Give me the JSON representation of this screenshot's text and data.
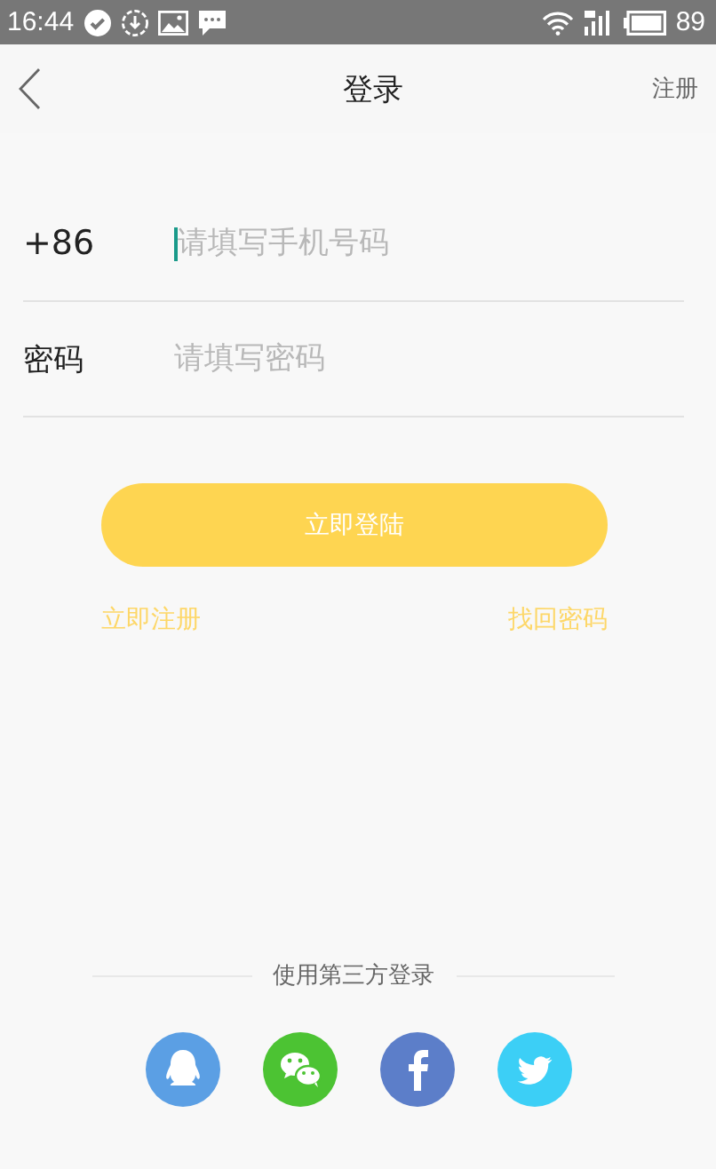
{
  "status_bar": {
    "time": "16:44",
    "battery": "89"
  },
  "nav": {
    "title": "登录",
    "action": "注册"
  },
  "form": {
    "fields": [
      {
        "kind": "phone",
        "label": "+86",
        "placeholder": "请填写手机号码",
        "focused": true
      },
      {
        "kind": "password",
        "label": "密码",
        "placeholder": "请填写密码",
        "focused": false
      }
    ]
  },
  "login_button": "立即登陆",
  "links": [
    "立即注册",
    "找回密码"
  ],
  "third_party": {
    "title": "使用第三方登录",
    "providers": [
      {
        "kind": "qq",
        "color": "#5b9fe4"
      },
      {
        "kind": "wechat",
        "color": "#4cc333"
      },
      {
        "kind": "facebook",
        "color": "#5c7ec9"
      },
      {
        "kind": "twitter",
        "color": "#3ccff6"
      }
    ]
  }
}
